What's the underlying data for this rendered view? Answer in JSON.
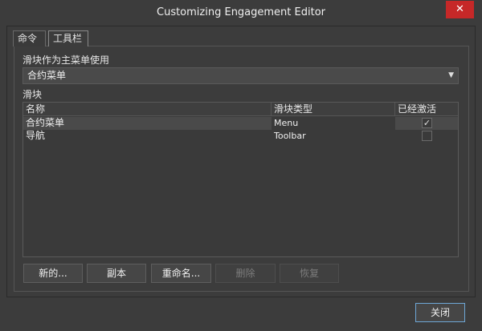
{
  "window": {
    "title": "Customizing Engagement Editor",
    "close_icon": "✕"
  },
  "tabs": [
    {
      "label": "命令"
    },
    {
      "label": "工具栏"
    }
  ],
  "main_menu": {
    "label": "滑块作为主菜单使用",
    "selected": "合约菜单"
  },
  "sliders": {
    "label": "滑块",
    "columns": [
      "名称",
      "滑块类型",
      "已经激活"
    ],
    "rows": [
      {
        "name": "合约菜单",
        "type": "Menu",
        "active": true,
        "check": "✓"
      },
      {
        "name": "导航",
        "type": "Toolbar",
        "active": false,
        "check": ""
      }
    ]
  },
  "buttons": {
    "new": "新的...",
    "copy": "副本",
    "rename": "重命名...",
    "delete": "删除",
    "restore": "恢复",
    "close": "关闭"
  }
}
